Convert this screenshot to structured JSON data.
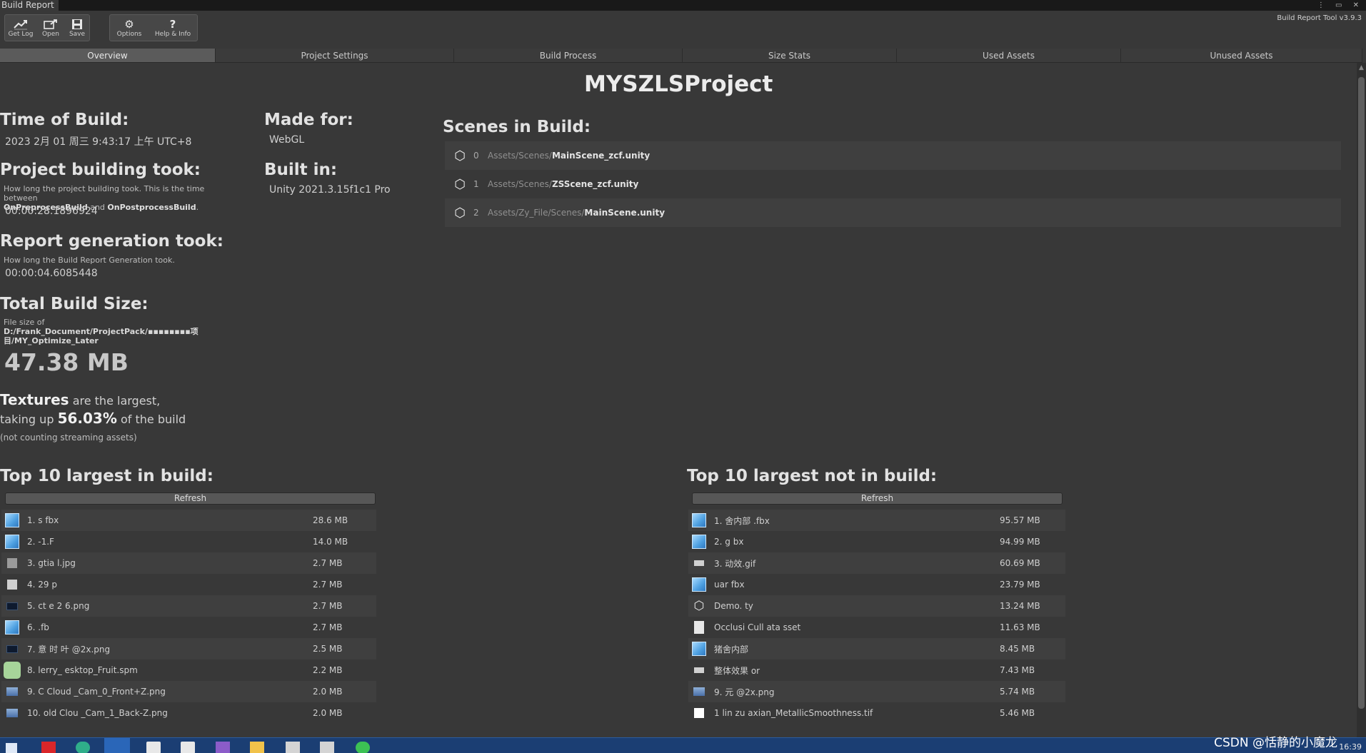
{
  "window": {
    "title": "Build Report",
    "controls": "⋮ ▭ ✕",
    "version": "Build Report Tool v3.9.3"
  },
  "toolbar": {
    "get_log": "Get Log",
    "open": "Open",
    "save": "Save",
    "options": "Options",
    "help": "Help & Info"
  },
  "tabs": [
    "Overview",
    "Project Settings",
    "Build Process",
    "Size Stats",
    "Used Assets",
    "Unused Assets"
  ],
  "project_name": "MYSZLSProject",
  "overview": {
    "time_of_build_label": "Time of Build:",
    "time_of_build": "2023 2月 01 周三 9:43:17 上午 UTC+8",
    "made_for_label": "Made for:",
    "made_for": "WebGL",
    "built_in_label": "Built in:",
    "built_in": "Unity 2021.3.15f1c1 Pro",
    "build_took_label": "Project building took:",
    "build_took_desc_1": "How long the project building took. This is the time between",
    "build_took_desc_pre": "OnPreprocessBuild",
    "build_took_desc_and": "and",
    "build_took_desc_post": "OnPostprocessBuild",
    "build_took": "00:00:28.1896924",
    "report_took_label": "Report generation took:",
    "report_took_desc": "How long the Build Report Generation took.",
    "report_took": "00:00:04.6085448",
    "total_size_label": "Total Build Size:",
    "file_size_of": "File size of",
    "file_path": "D:/Frank_Document/ProjectPack/▪▪▪▪▪▪▪▪项目/MY_Optimize_Later",
    "total_size": "47.38 MB",
    "largest_category": "Textures",
    "largest_text_1": "are the largest,",
    "largest_text_2": "taking up",
    "largest_percent": "56.03%",
    "largest_text_3": "of the build",
    "largest_note": "(not counting streaming assets)"
  },
  "scenes": {
    "label": "Scenes in Build:",
    "items": [
      {
        "index": "0",
        "path": "Assets/Scenes/",
        "file": "MainScene_zcf.unity"
      },
      {
        "index": "1",
        "path": "Assets/Scenes/",
        "file": "ZSScene_zcf.unity"
      },
      {
        "index": "2",
        "path": "Assets/Zy_File/Scenes/",
        "file": "MainScene.unity"
      }
    ]
  },
  "top_in_build": {
    "label": "Top 10 largest in build:",
    "refresh": "Refresh",
    "items": [
      {
        "name": "1.     s   fbx",
        "size": "28.6 MB",
        "icon": "model-icon"
      },
      {
        "name": "2.     -1.F",
        "size": "14.0 MB",
        "icon": "model-icon"
      },
      {
        "name": "3.   gtia     l.jpg",
        "size": "2.7 MB",
        "icon": "gray-image-icon"
      },
      {
        "name": "4.   29    p",
        "size": "2.7 MB",
        "icon": "light-image-icon"
      },
      {
        "name": "5.   ct    e 2 6.png",
        "size": "2.7 MB",
        "icon": "dark-image-icon"
      },
      {
        "name": "6.        .fb",
        "size": "2.7 MB",
        "icon": "model-icon"
      },
      {
        "name": "7.    意 时 叶   @2x.png",
        "size": "2.5 MB",
        "icon": "dark-image-icon"
      },
      {
        "name": "8.   lerry_  esktop_Fruit.spm",
        "size": "2.2 MB",
        "icon": "tree-icon"
      },
      {
        "name": "9. C   Cloud   _Cam_0_Front+Z.png",
        "size": "2.0 MB",
        "icon": "sky-image-icon"
      },
      {
        "name": "10.  old Clou   _Cam_1_Back-Z.png",
        "size": "2.0 MB",
        "icon": "sky-image-icon"
      }
    ]
  },
  "top_not_in_build": {
    "label": "Top 10 largest not in build:",
    "refresh": "Refresh",
    "items": [
      {
        "name": "1.    舍内部   .fbx",
        "size": "95.57 MB",
        "icon": "model-icon"
      },
      {
        "name": "2.       g    bx",
        "size": "94.99 MB",
        "icon": "model-icon"
      },
      {
        "name": "3.       动效.gif",
        "size": "60.69 MB",
        "icon": "small-image-icon"
      },
      {
        "name": "     uar    fbx",
        "size": "23.79 MB",
        "icon": "model-icon"
      },
      {
        "name": "     Demo.    ty",
        "size": "13.24 MB",
        "icon": "unity-icon"
      },
      {
        "name": "     Occlusi   Cull   ata  sset",
        "size": "11.63 MB",
        "icon": "document-icon"
      },
      {
        "name": "     猪舍内部",
        "size": "8.45 MB",
        "icon": "model-icon"
      },
      {
        "name": "     整体效果    or",
        "size": "7.43 MB",
        "icon": "small-image-icon"
      },
      {
        "name": "9.   元         @2x.png",
        "size": "5.74 MB",
        "icon": "sky-image-icon"
      },
      {
        "name": "1    lin  zu   axian_MetallicSmoothness.tif",
        "size": "5.46 MB",
        "icon": "white-image-icon"
      }
    ]
  },
  "taskbar": {
    "watermark": "CSDN @恬静的小魔龙",
    "clock": "16:39"
  },
  "colors": {
    "background": "#383838",
    "tab_active": "#5b5b5b",
    "taskbar": "#1b3e73"
  }
}
